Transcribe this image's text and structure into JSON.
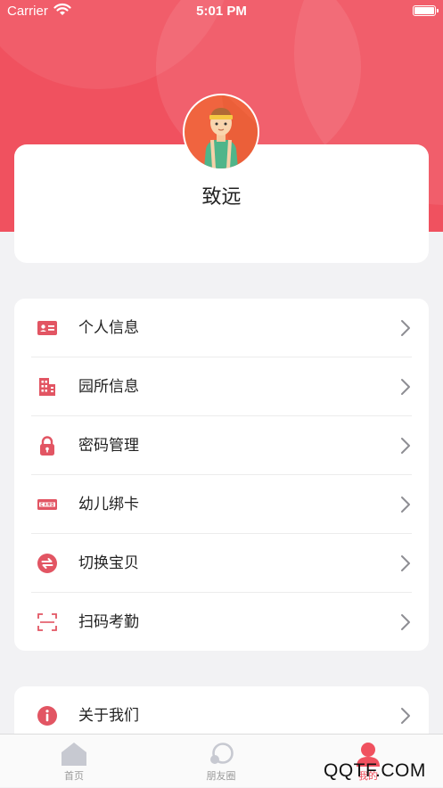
{
  "status_bar": {
    "carrier": "Carrier",
    "time": "5:01 PM"
  },
  "profile": {
    "name": "致远"
  },
  "menu": {
    "items": [
      {
        "label": "个人信息",
        "icon": "id-card-icon"
      },
      {
        "label": "园所信息",
        "icon": "building-icon"
      },
      {
        "label": "密码管理",
        "icon": "lock-icon"
      },
      {
        "label": "幼儿绑卡",
        "icon": "card-icon"
      },
      {
        "label": "切换宝贝",
        "icon": "switch-icon"
      },
      {
        "label": "扫码考勤",
        "icon": "scan-icon"
      }
    ]
  },
  "about": {
    "label": "关于我们",
    "icon": "info-icon"
  },
  "tabbar": {
    "tabs": [
      {
        "label": "首页",
        "icon": "home-icon"
      },
      {
        "label": "朋友圈",
        "icon": "moments-icon"
      },
      {
        "label": "我的",
        "icon": "profile-icon",
        "active": true
      }
    ]
  },
  "watermark": "QQTF.COM",
  "colors": {
    "accent": "#f0515f",
    "icon": "#e25563",
    "background": "#f2f2f4"
  }
}
